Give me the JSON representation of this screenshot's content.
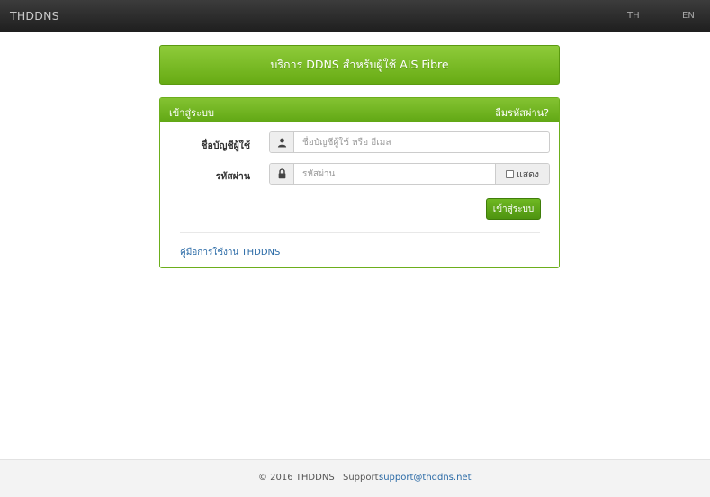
{
  "navbar": {
    "brand": "THDDNS",
    "lang_th": "TH",
    "lang_en": "EN"
  },
  "banner": {
    "text": "บริการ DDNS สำหรับผู้ใช้ AIS Fibre"
  },
  "login_panel": {
    "title": "เข้าสู่ระบบ",
    "forgot_link": "ลืมรหัสผ่าน?",
    "username_label": "ชื่อบัญชีผู้ใช้",
    "username_placeholder": "ชื่อบัญชีผู้ใช้ หรือ อีเมล",
    "password_label": "รหัสผ่าน",
    "password_placeholder": "รหัสผ่าน",
    "show_label": "แสดง",
    "submit_label": "เข้าสู่ระบบ",
    "manual_link": "คู่มือการใช้งาน THDDNS"
  },
  "footer": {
    "copyright": "© 2016 THDDNS",
    "support_label": "Support:",
    "support_email": "support@thddns.net"
  },
  "colors": {
    "accent_green": "#67ab14",
    "link_blue": "#2a6aa6",
    "navbar_dark": "#2a2a2a"
  },
  "icons": {
    "username_icon": "user-icon",
    "password_icon": "lock-icon"
  }
}
